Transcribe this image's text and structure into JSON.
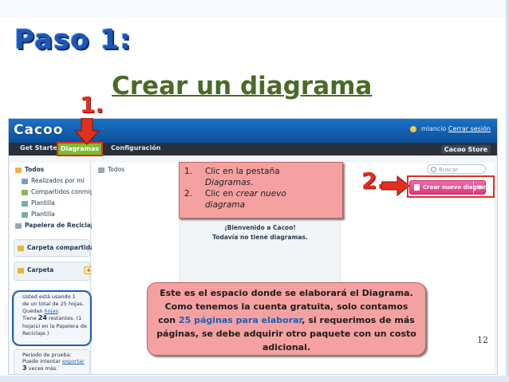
{
  "slide": {
    "heading": "Paso 1:",
    "title": "Crear un diagrama",
    "marker_1": "1.",
    "marker_2": "2.",
    "page_number": "12"
  },
  "app": {
    "logo": "Cacoo",
    "user_name": "mlancio",
    "logout_label": "Cerrar sesión",
    "store_label": "Cacoo Store",
    "nav": {
      "get_started": "Get Started",
      "diagramas": "Diagramas",
      "configuracion": "Configuración"
    },
    "sidebar": {
      "todos": "Todos",
      "realizados": "Realizados por mí",
      "compartidos": "Compartidos conmigo",
      "plantilla1": "Plantilla",
      "plantilla2": "Plantilla",
      "papelera": "Papelera de Reciclaje",
      "carpeta_compartida": "Carpeta compartida",
      "carpeta": "Carpeta",
      "info_line1": "Usted está usando 1",
      "info_line2": "de un total de 25 hojas.",
      "info_line3_pre": "Quedan",
      "info_line3_link": "hojas",
      "info_line3_post": ":",
      "info_line4_pre": "Tiene",
      "info_line4_num": "24",
      "info_line4_post": "restantes. (1",
      "info_line5": "hoja(s) en la Papelera de",
      "info_line6": "Reciclaje.)",
      "trial_line1": "Periodo de prueba:",
      "trial_line2_pre": "Puede intentar",
      "trial_line2_link": "exportar",
      "trial_line3_num": "3",
      "trial_line3_post": "veces más."
    },
    "main": {
      "header": "Todos",
      "search_placeholder": "Buscar",
      "create_button": "Crear nuevo diagrama",
      "welcome_title": "¡Bienvenido a Cacoo!",
      "welcome_sub": "Todavía no tiene diagramas."
    }
  },
  "steps": {
    "s1_num": "1.",
    "s1_line1": "Clic en la pestaña",
    "s1_line2": "Diagramas",
    "s1_line2_end": ".",
    "s2_num": "2.",
    "s2_line1_pre": "Clic en",
    "s2_line1_em": "crear nuevo",
    "s2_line2": "diagrama"
  },
  "note": {
    "line1": "Este es el espacio donde se elaborará el Diagrama.",
    "line2": "Como tenemos la cuenta gratuita, solo contamos",
    "line3_pre": "con",
    "line3_hl": "25 páginas para elaborar",
    "line3_post": ", si requerimos de más",
    "line4": "páginas, se debe adquirir otro paquete con un costo",
    "line5": "adicional."
  },
  "colors": {
    "heading": "#1c57b8",
    "title": "#4a6a26",
    "marker": "#e0301e",
    "callout": "#f6a1a1",
    "create_button": "#e0508f",
    "nav_active": "#7cbc2e",
    "topbar": "#1a72c6"
  }
}
